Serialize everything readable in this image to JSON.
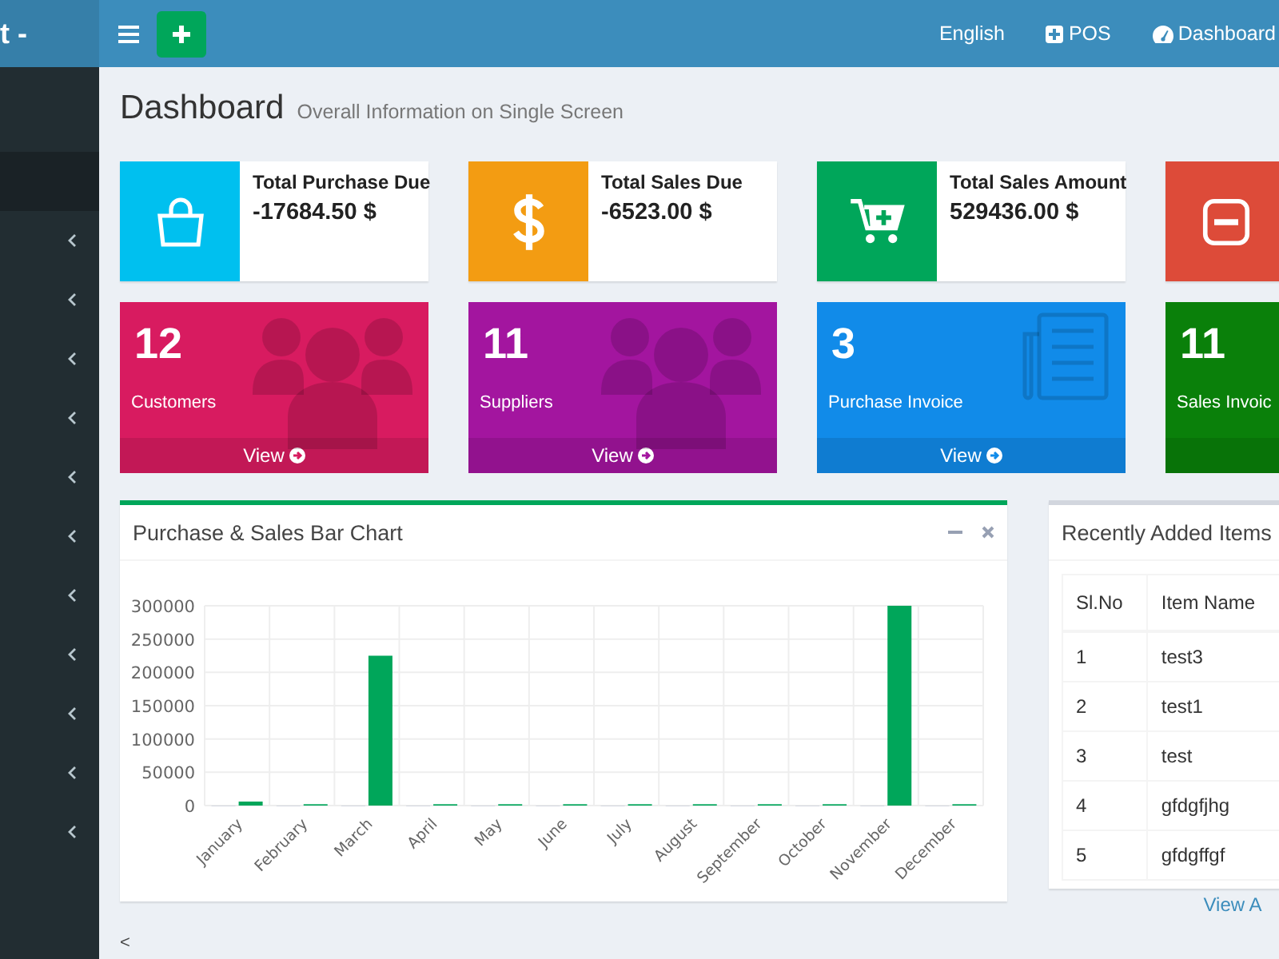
{
  "header": {
    "logo": "t -",
    "nav": [
      {
        "kind": "text",
        "label": "English"
      },
      {
        "kind": "pos",
        "label": "POS"
      },
      {
        "kind": "gauge",
        "label": "Dashboard"
      }
    ]
  },
  "sidebar": {
    "items": [
      {
        "selected": true,
        "expandable": false
      },
      {
        "selected": false,
        "expandable": true
      },
      {
        "selected": false,
        "expandable": true
      },
      {
        "selected": false,
        "expandable": true
      },
      {
        "selected": false,
        "expandable": true
      },
      {
        "selected": false,
        "expandable": true
      },
      {
        "selected": false,
        "expandable": true
      },
      {
        "selected": false,
        "expandable": true
      },
      {
        "selected": false,
        "expandable": true
      },
      {
        "selected": false,
        "expandable": true
      },
      {
        "selected": false,
        "expandable": true
      },
      {
        "selected": false,
        "expandable": true
      }
    ]
  },
  "page": {
    "title": "Dashboard",
    "subtitle": "Overall Information on Single Screen"
  },
  "info_boxes": [
    {
      "kind": "bag",
      "color": "#00c0ef",
      "label": "Total Purchase Due",
      "value": "-17684.50 $"
    },
    {
      "kind": "dollar",
      "color": "#f39c12",
      "label": "Total Sales Due",
      "value": "-6523.00 $"
    },
    {
      "kind": "cart",
      "color": "#00a65a",
      "label": "Total Sales Amount",
      "value": "529436.00 $"
    },
    {
      "kind": "minus",
      "color": "#dd4b39"
    }
  ],
  "stat_boxes": [
    {
      "kind": "users",
      "color": "#d81b60",
      "count": "12",
      "label": "Customers",
      "link": "View"
    },
    {
      "kind": "users",
      "color": "#a3159f",
      "count": "11",
      "label": "Suppliers",
      "link": "View"
    },
    {
      "kind": "document",
      "color": "#118be9",
      "count": "3",
      "label": "Purchase Invoice",
      "link": "View"
    },
    {
      "kind": "none",
      "color": "#0a800a",
      "count": "11",
      "label": "Sales Invoic"
    }
  ],
  "chart_box": {
    "title": "Purchase & Sales Bar Chart",
    "chart_data": {
      "type": "bar",
      "categories": [
        "January",
        "February",
        "March",
        "April",
        "May",
        "June",
        "July",
        "August",
        "September",
        "October",
        "November",
        "December"
      ],
      "series": [
        {
          "color": "#d2d6de",
          "values": [
            0,
            0,
            0,
            0,
            0,
            0,
            0,
            0,
            0,
            0,
            0,
            0
          ]
        },
        {
          "color": "#00a65a",
          "values": [
            6000,
            2000,
            225000,
            2000,
            2000,
            2000,
            2000,
            2000,
            2000,
            2000,
            300000,
            2000
          ]
        }
      ],
      "ylim": [
        0,
        300000
      ],
      "grid": true,
      "yticks": [
        0,
        50000,
        100000,
        150000,
        200000,
        250000,
        300000
      ]
    }
  },
  "items_box": {
    "title": "Recently Added Items",
    "columns": [
      "Sl.No",
      "Item Name"
    ],
    "rows": [
      [
        "1",
        "test3"
      ],
      [
        "2",
        "test1"
      ],
      [
        "3",
        "test"
      ],
      [
        "4",
        "gfdgfjhg"
      ],
      [
        "5",
        "gfdgffgf"
      ]
    ],
    "link": "View A"
  },
  "footer": {
    "toggle": "<"
  }
}
